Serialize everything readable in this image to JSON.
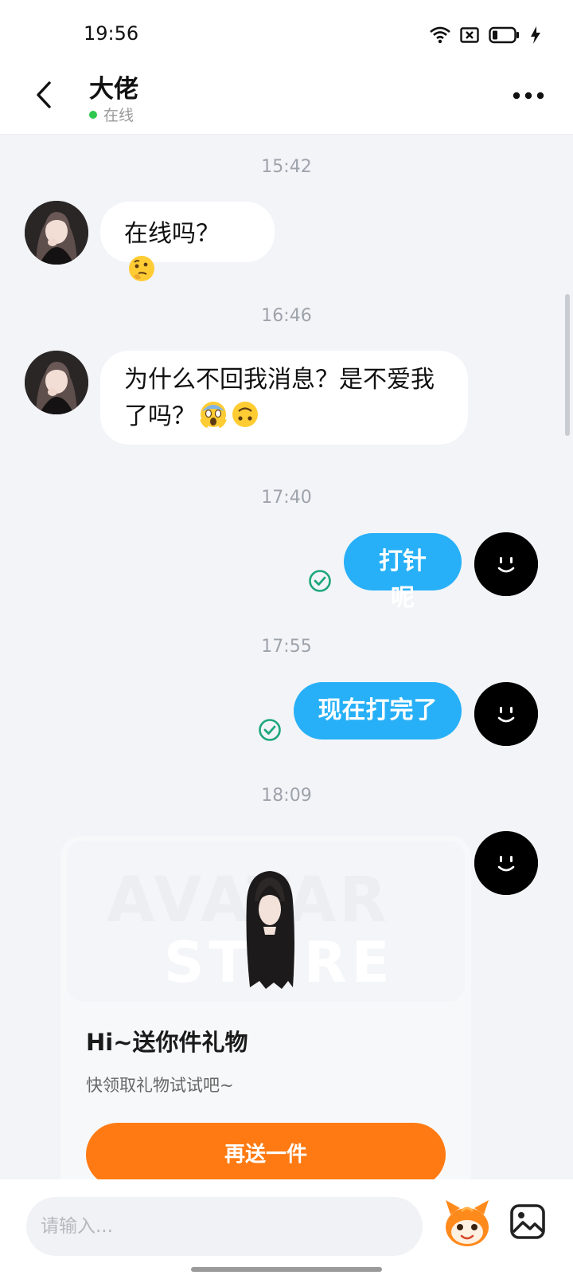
{
  "status_bar": {
    "time": "19:56"
  },
  "header": {
    "contact_name": "大佬",
    "status_text": "在线",
    "status_color": "#2ec84e"
  },
  "messages": [
    {
      "type": "timestamp",
      "text": "15:42"
    },
    {
      "type": "incoming",
      "text": "在线吗？",
      "emojis": [
        "thinking-face"
      ]
    },
    {
      "type": "timestamp",
      "text": "16:46"
    },
    {
      "type": "incoming",
      "lines": [
        "为什么不回我消息？是不爱我",
        "了吗？"
      ],
      "emojis": [
        "face-screaming-in-fear",
        "upside-down-face"
      ]
    },
    {
      "type": "timestamp",
      "text": "17:40"
    },
    {
      "type": "outgoing",
      "text": "打针呢",
      "read": true
    },
    {
      "type": "timestamp",
      "text": "17:55"
    },
    {
      "type": "outgoing",
      "text": "现在打完了",
      "read": true
    },
    {
      "type": "timestamp",
      "text": "18:09"
    }
  ],
  "gift_card": {
    "watermark_line1": "AVATAR",
    "watermark_line2": "STORE",
    "title": "Hi~送你件礼物",
    "description": "快领取礼物试试吧~",
    "button_label": "再送一件"
  },
  "input_bar": {
    "placeholder": "请输入..."
  },
  "colors": {
    "outgoing_bubble": "#27b0f7",
    "incoming_bubble": "#ffffff",
    "chat_background": "#f2f4f8",
    "gift_button": "#ff7a12",
    "read_check": "#1fa77a"
  },
  "icons": {
    "back": "chevron-left-icon",
    "more": "more-dots-icon",
    "read": "check-circle-icon",
    "sticker": "mascot-icon",
    "image": "image-icon"
  }
}
